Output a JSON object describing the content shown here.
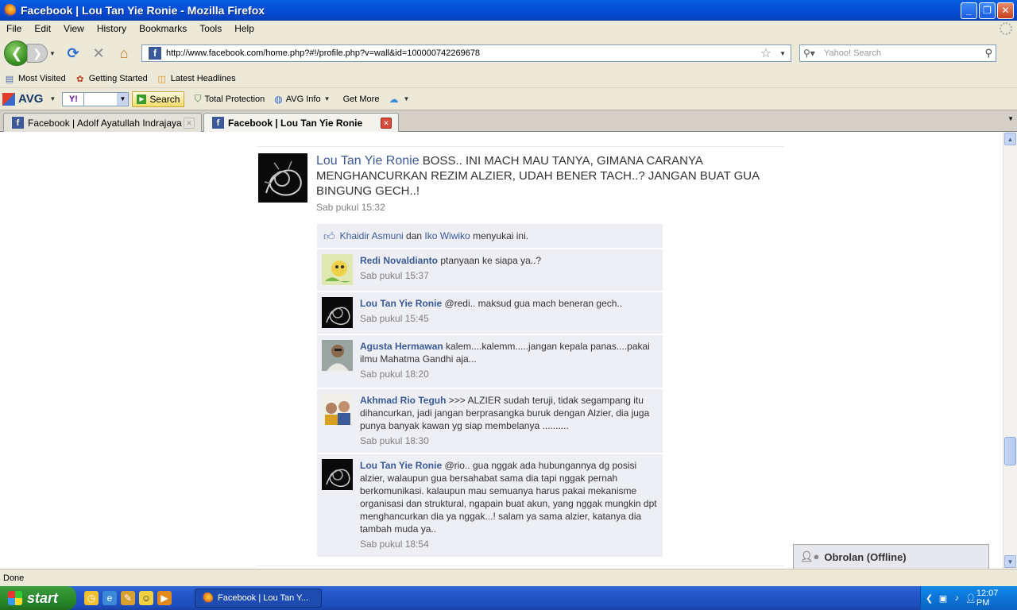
{
  "window": {
    "title": "Facebook | Lou Tan Yie Ronie - Mozilla Firefox",
    "minimize": "_",
    "maximize": "❐",
    "close": "✕"
  },
  "menu": {
    "items": [
      "File",
      "Edit",
      "View",
      "History",
      "Bookmarks",
      "Tools",
      "Help"
    ]
  },
  "nav": {
    "url": "http://www.facebook.com/home.php?#!/profile.php?v=wall&id=100000742269678",
    "search_placeholder": "Yahoo! Search"
  },
  "bookmarks": {
    "items": [
      "Most Visited",
      "Getting Started",
      "Latest Headlines"
    ]
  },
  "avg": {
    "logo": "AVG",
    "yahoo_label": "Y!",
    "search_label": "Search",
    "total_protection": "Total Protection",
    "avg_info": "AVG Info",
    "get_more": "Get More"
  },
  "tabs": [
    {
      "label": "Facebook | Adolf Ayatullah Indrajaya",
      "active": false
    },
    {
      "label": "Facebook | Lou Tan Yie Ronie",
      "active": true
    }
  ],
  "post": {
    "author": "Lou Tan Yie Ronie",
    "text": " BOSS.. INI MACH MAU TANYA, GIMANA CARANYA MENGHANCURKAN REZIM ALZIER, UDAH BENER TACH..? JANGAN BUAT GUA BINGUNG GECH..!",
    "time": "Sab pukul 15:32",
    "likes": {
      "name1": "Khaidir Asmuni",
      "conj": " dan ",
      "name2": "Iko Wiwiko",
      "suffix": " menyukai ini."
    },
    "comments": [
      {
        "name": "Redi Novaldianto",
        "text": " ptanyaan ke siapa ya..?",
        "time": "Sab pukul 15:37"
      },
      {
        "name": "Lou Tan Yie Ronie",
        "text": " @redi.. maksud gua mach beneran gech..",
        "time": "Sab pukul 15:45"
      },
      {
        "name": "Agusta Hermawan",
        "text": " kalem....kalemm.....jangan kepala panas....pakai ilmu Mahatma Gandhi aja...",
        "time": "Sab pukul 18:20"
      },
      {
        "name": "Akhmad Rio Teguh",
        "text": " >>> ALZIER sudah teruji, tidak segampang itu dihancurkan, jadi jangan berprasangka buruk dengan Alzier, dia juga punya banyak kawan yg siap membelanya ..........",
        "time": "Sab pukul 18:30"
      },
      {
        "name": "Lou Tan Yie Ronie",
        "text": " @rio.. gua nggak ada hubungannya dg posisi alzier, walaupun gua bersahabat sama dia tapi nggak pernah berkomunikasi. kalaupun mau semuanya harus pakai mekanisme organisasi dan struktural, ngapain buat akun, yang nggak mungkin dpt menghancurkan dia ya nggak...! salam ya sama alzier, katanya dia tambah muda ya..",
        "time": "Sab pukul 18:54"
      }
    ]
  },
  "chat": {
    "label": "Obrolan (Offline)"
  },
  "status": {
    "text": "Done"
  },
  "taskbar": {
    "start": "start",
    "task_label": "Facebook | Lou Tan Y...",
    "clock": "12:07 PM"
  },
  "colors": {
    "fb_blue": "#3b5998",
    "comment_bg": "#edeff4",
    "xp_blue": "#0a5fe0"
  }
}
